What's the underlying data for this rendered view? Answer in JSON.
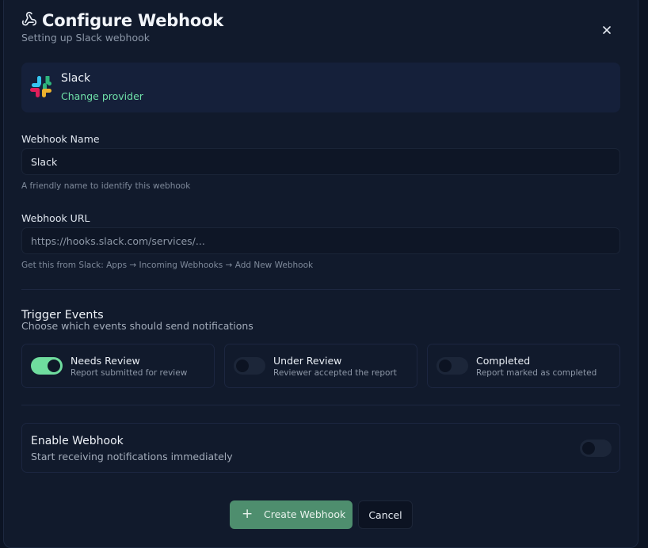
{
  "dialog": {
    "title": "Configure Webhook",
    "subtitle": "Setting up Slack webhook",
    "close_icon": "close-icon"
  },
  "provider": {
    "name": "Slack",
    "change_label": "Change provider",
    "icon": "slack-logo"
  },
  "fields": {
    "name": {
      "label": "Webhook Name",
      "value": "Slack",
      "hint": "A friendly name to identify this webhook"
    },
    "url": {
      "label": "Webhook URL",
      "value": "",
      "placeholder": "https://hooks.slack.com/services/...",
      "hint": "Get this from Slack: Apps → Incoming Webhooks → Add New Webhook"
    }
  },
  "triggers": {
    "title": "Trigger Events",
    "subtitle": "Choose which events should send notifications",
    "events": [
      {
        "title": "Needs Review",
        "desc": "Report submitted for review",
        "enabled": true
      },
      {
        "title": "Under Review",
        "desc": "Reviewer accepted the report",
        "enabled": false
      },
      {
        "title": "Completed",
        "desc": "Report marked as completed",
        "enabled": false
      }
    ]
  },
  "enable": {
    "title": "Enable Webhook",
    "desc": "Start receiving notifications immediately",
    "enabled": false
  },
  "actions": {
    "create_label": "Create Webhook",
    "cancel_label": "Cancel"
  },
  "colors": {
    "accent": "#6fdc9e",
    "primary_button": "#4e8e6e",
    "background": "#111a2c"
  }
}
